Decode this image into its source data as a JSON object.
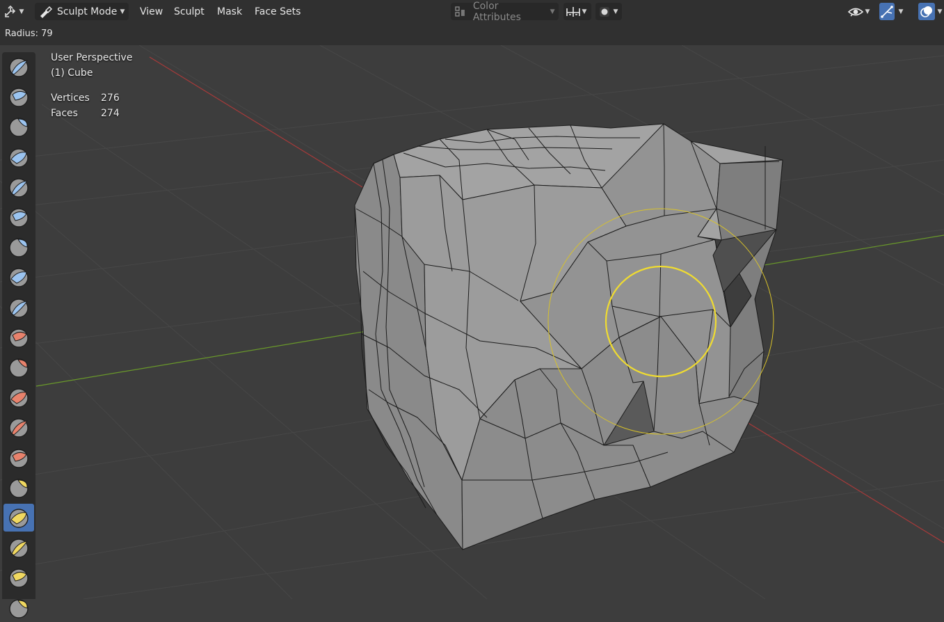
{
  "header": {
    "mode_label": "Sculpt Mode",
    "menus": [
      "View",
      "Sculpt",
      "Mask",
      "Face Sets"
    ],
    "color_attributes_label": "Color Attributes"
  },
  "tool_settings": {
    "radius_text": "Radius: 79"
  },
  "viewport": {
    "perspective_label": "User Perspective",
    "object_label": "(1) Cube",
    "stats": [
      {
        "label": "Vertices",
        "value": "276"
      },
      {
        "label": "Faces",
        "value": "274"
      }
    ]
  },
  "toolbar": {
    "tools": [
      {
        "icon": "draw-brush-icon",
        "color": "#9bc4f0"
      },
      {
        "icon": "draw-sharp-brush-icon",
        "color": "#9bc4f0"
      },
      {
        "icon": "clay-brush-icon",
        "color": "#9bc4f0"
      },
      {
        "icon": "clay-strips-brush-icon",
        "color": "#9bc4f0"
      },
      {
        "icon": "clay-thumb-brush-icon",
        "color": "#9bc4f0"
      },
      {
        "icon": "layer-brush-icon",
        "color": "#9bc4f0"
      },
      {
        "icon": "inflate-brush-icon",
        "color": "#9bc4f0"
      },
      {
        "icon": "blob-brush-icon",
        "color": "#9bc4f0"
      },
      {
        "icon": "crease-brush-icon",
        "color": "#9bc4f0"
      },
      {
        "icon": "smooth-brush-icon",
        "color": "#e8826c"
      },
      {
        "icon": "flatten-brush-icon",
        "color": "#e8826c"
      },
      {
        "icon": "fill-brush-icon",
        "color": "#e8826c"
      },
      {
        "icon": "scrape-brush-icon",
        "color": "#e8826c"
      },
      {
        "icon": "multiplane-scrape-brush-icon",
        "color": "#e8826c"
      },
      {
        "icon": "pinch-brush-icon",
        "color": "#f0d860"
      },
      {
        "icon": "grab-brush-icon",
        "color": "#f0d860",
        "active": true
      },
      {
        "icon": "elastic-deform-brush-icon",
        "color": "#f0d860"
      },
      {
        "icon": "snake-hook-brush-icon",
        "color": "#f0d860"
      },
      {
        "icon": "thumb-brush-icon",
        "color": "#f0d860"
      }
    ]
  },
  "colors": {
    "header_bg": "#303030",
    "viewport_bg": "#3d3d3d",
    "active_tool": "#4772b3",
    "brush_circle": "#f0dc30",
    "x_axis": "#a83a3a",
    "y_axis": "#6a9a2a"
  }
}
